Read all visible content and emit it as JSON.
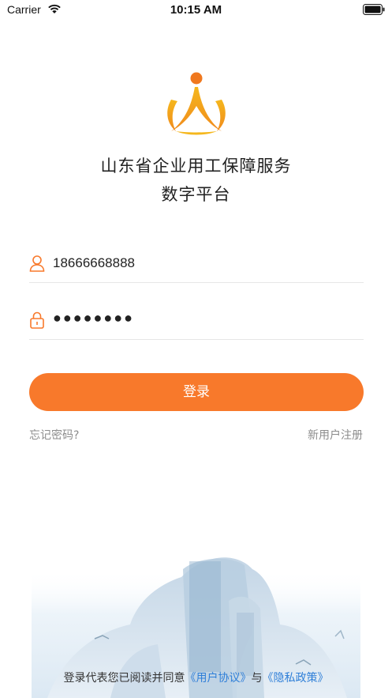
{
  "status_bar": {
    "carrier": "Carrier",
    "time": "10:15 AM"
  },
  "app": {
    "title_line1": "山东省企业用工保障服务",
    "title_line2": "数字平台"
  },
  "login_form": {
    "username_value": "18666668888",
    "password_value": "●●●●●●●●",
    "login_label": "登录",
    "forgot_label": "忘记密码?",
    "register_label": "新用户注册"
  },
  "agreement": {
    "prefix": "登录代表您已阅读并同意",
    "user_agreement": "《用户协议》",
    "and": "与",
    "privacy_policy": "《隐私政策》"
  },
  "colors": {
    "accent": "#f8792b",
    "link": "#2f7fd8",
    "logo_yellow": "#f5b71d"
  },
  "icons": [
    "wifi-icon",
    "battery-icon",
    "user-icon",
    "lock-icon"
  ]
}
